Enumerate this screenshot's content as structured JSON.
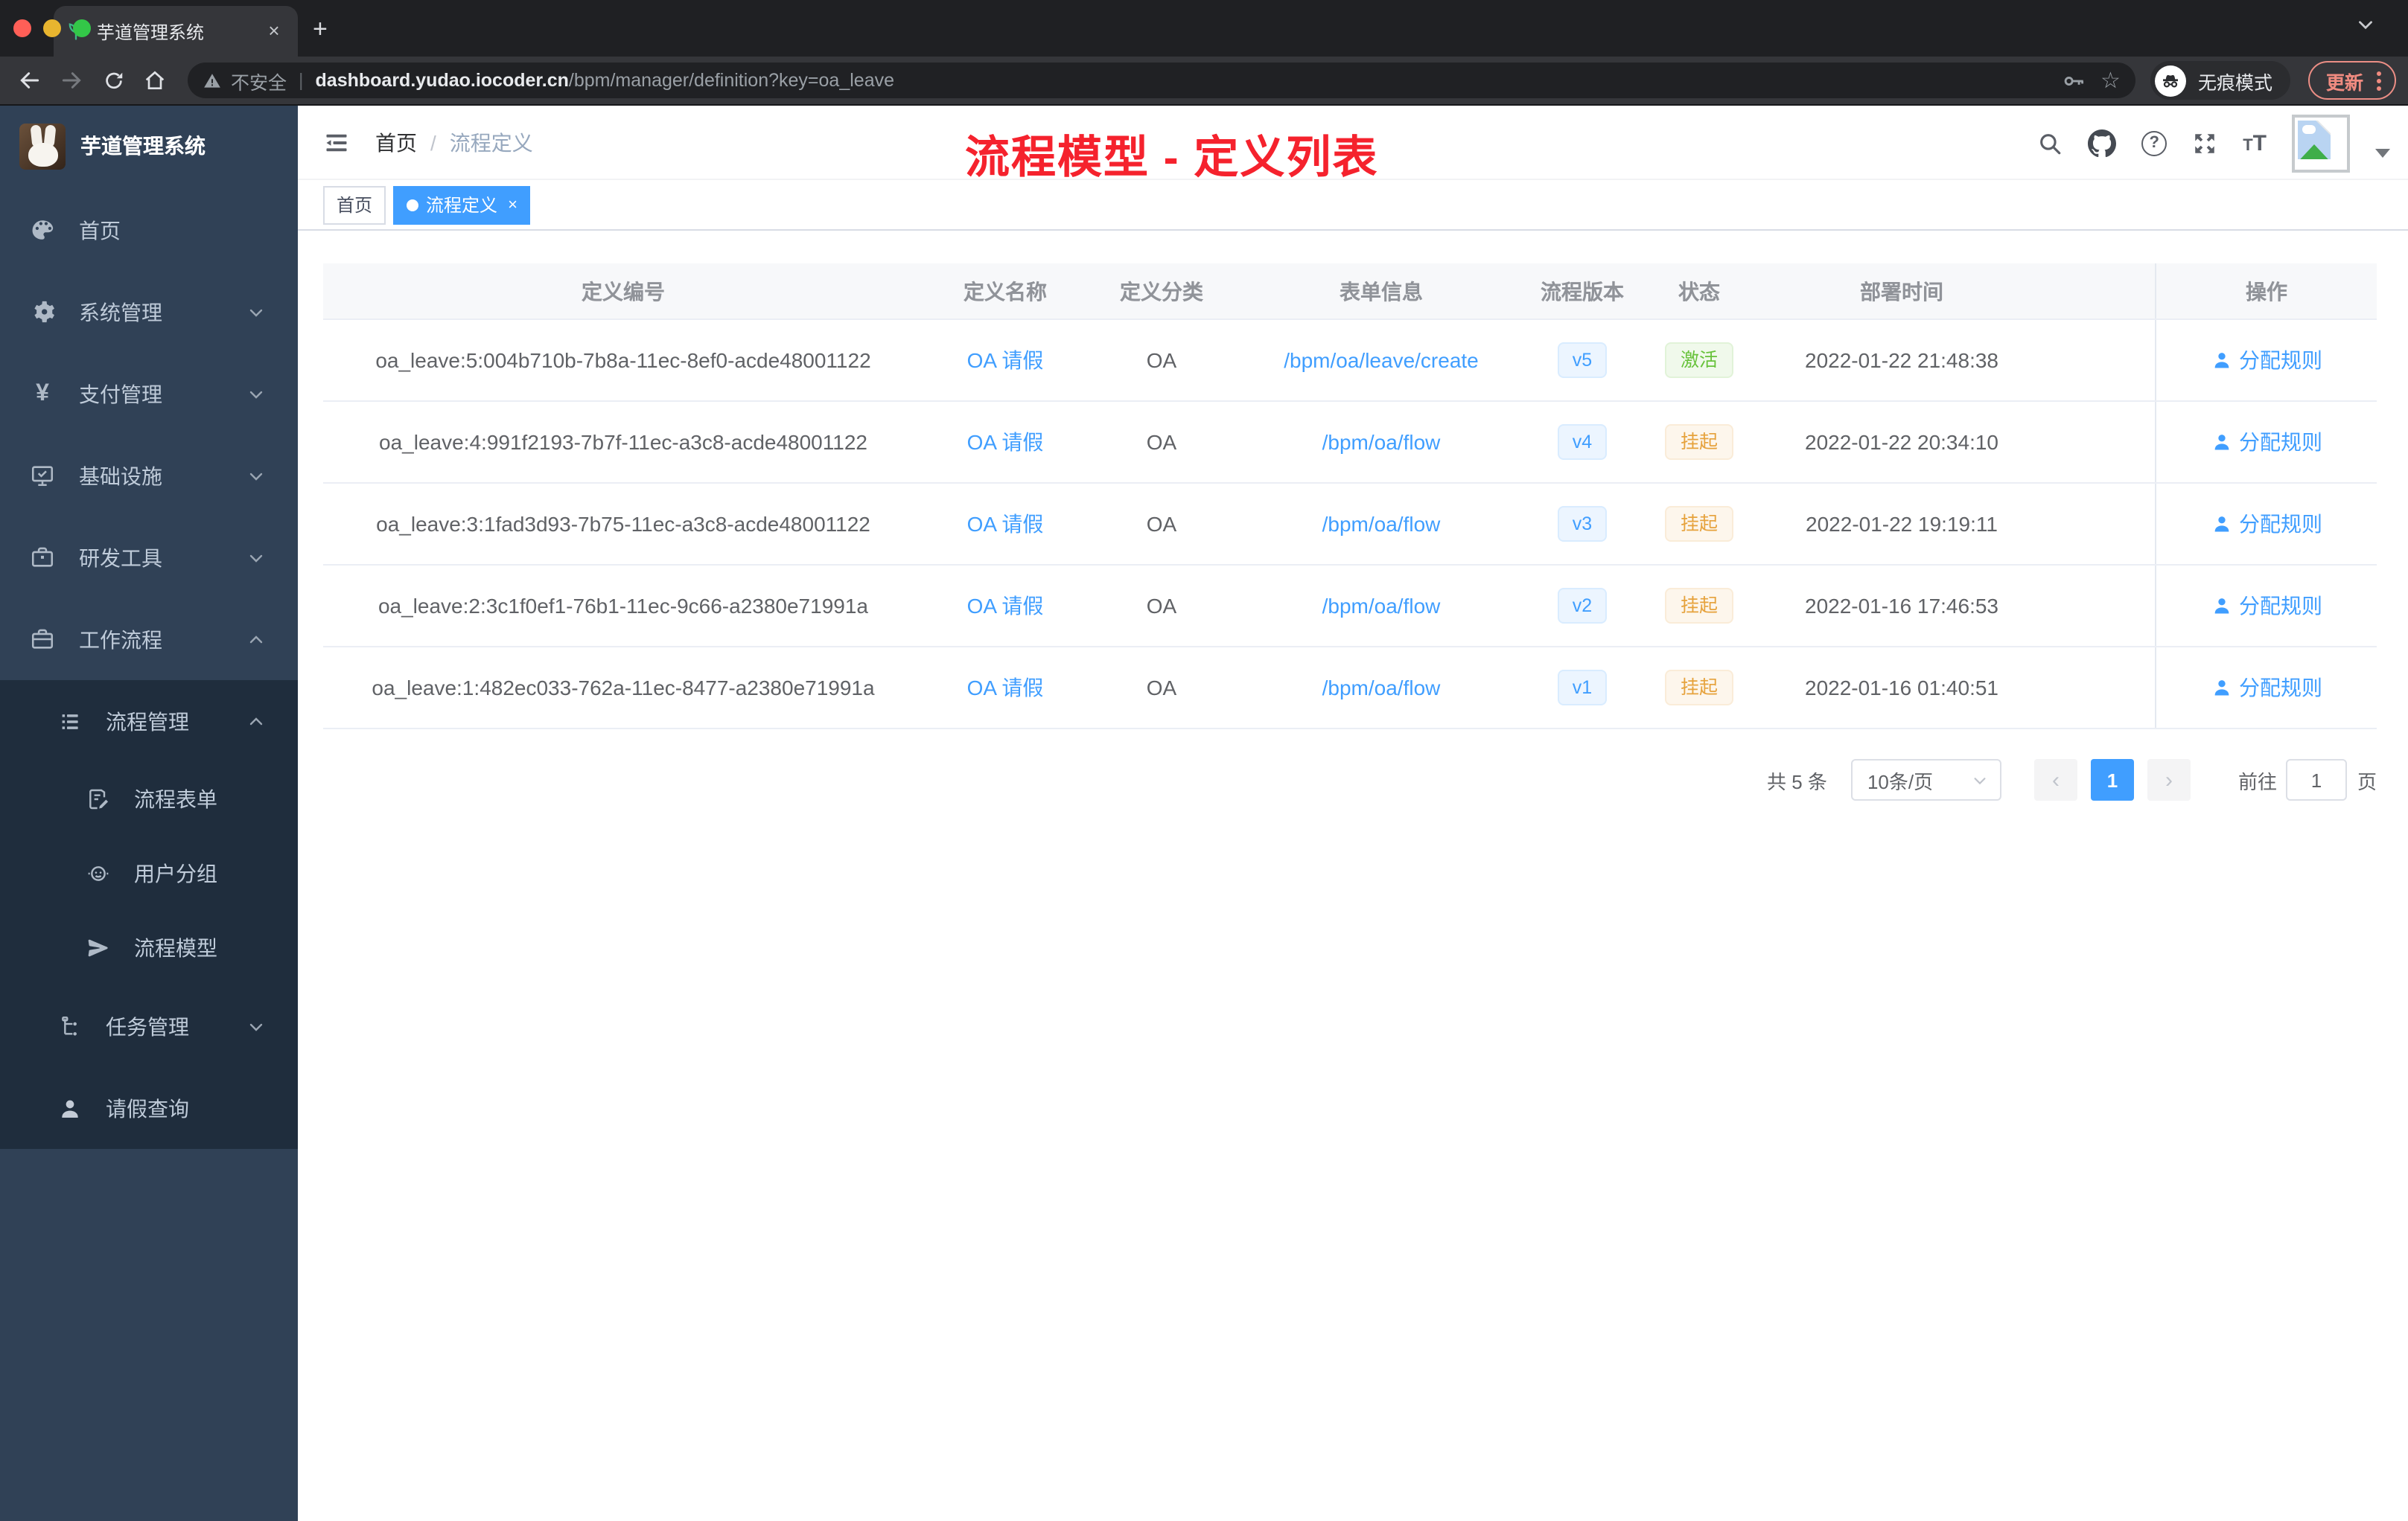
{
  "browser": {
    "tab_title": "芋道管理系统",
    "tab_close": "×",
    "new_tab": "+",
    "security_label": "不安全",
    "url_domain": "dashboard.yudao.iocoder.cn",
    "url_path": "/bpm/manager/definition?key=oa_leave",
    "incognito_label": "无痕模式",
    "update_label": "更新"
  },
  "sidebar": {
    "app_title": "芋道管理系统",
    "items": [
      {
        "label": "首页"
      },
      {
        "label": "系统管理"
      },
      {
        "label": "支付管理"
      },
      {
        "label": "基础设施"
      },
      {
        "label": "研发工具"
      },
      {
        "label": "工作流程"
      },
      {
        "label": "流程管理"
      },
      {
        "label": "流程表单"
      },
      {
        "label": "用户分组"
      },
      {
        "label": "流程模型"
      },
      {
        "label": "任务管理"
      },
      {
        "label": "请假查询"
      }
    ]
  },
  "header": {
    "breadcrumb": {
      "home": "首页",
      "separator": "/",
      "current": "流程定义"
    },
    "annotation": "流程模型 - 定义列表"
  },
  "tags": {
    "home": "首页",
    "active": "流程定义",
    "close": "×"
  },
  "table": {
    "headers": [
      "定义编号",
      "定义名称",
      "定义分类",
      "表单信息",
      "流程版本",
      "状态",
      "部署时间",
      "操作"
    ],
    "rows": [
      {
        "id": "oa_leave:5:004b710b-7b8a-11ec-8ef0-acde48001122",
        "name": "OA 请假",
        "category": "OA",
        "form": "/bpm/oa/leave/create",
        "version": "v5",
        "status": "激活",
        "time": "2022-01-22 21:48:38",
        "action": "分配规则"
      },
      {
        "id": "oa_leave:4:991f2193-7b7f-11ec-a3c8-acde48001122",
        "name": "OA 请假",
        "category": "OA",
        "form": "/bpm/oa/flow",
        "version": "v4",
        "status": "挂起",
        "time": "2022-01-22 20:34:10",
        "action": "分配规则"
      },
      {
        "id": "oa_leave:3:1fad3d93-7b75-11ec-a3c8-acde48001122",
        "name": "OA 请假",
        "category": "OA",
        "form": "/bpm/oa/flow",
        "version": "v3",
        "status": "挂起",
        "time": "2022-01-22 19:19:11",
        "action": "分配规则"
      },
      {
        "id": "oa_leave:2:3c1f0ef1-76b1-11ec-9c66-a2380e71991a",
        "name": "OA 请假",
        "category": "OA",
        "form": "/bpm/oa/flow",
        "version": "v2",
        "status": "挂起",
        "time": "2022-01-16 17:46:53",
        "action": "分配规则"
      },
      {
        "id": "oa_leave:1:482ec033-762a-11ec-8477-a2380e71991a",
        "name": "OA 请假",
        "category": "OA",
        "form": "/bpm/oa/flow",
        "version": "v1",
        "status": "挂起",
        "time": "2022-01-16 01:40:51",
        "action": "分配规则"
      }
    ]
  },
  "pagination": {
    "total": "共 5 条",
    "page_size": "10条/页",
    "prev": "‹",
    "page": "1",
    "next": "›",
    "goto": "前往",
    "page_value": "1",
    "unit": "页"
  },
  "colors": {
    "accent": "#409eff",
    "sidebar_bg": "#304156",
    "submenu_bg": "#1f2d3d",
    "status_active_green": "#67c23a",
    "status_suspend_orange": "#e6a23c",
    "annotation_red": "#f5222d"
  }
}
